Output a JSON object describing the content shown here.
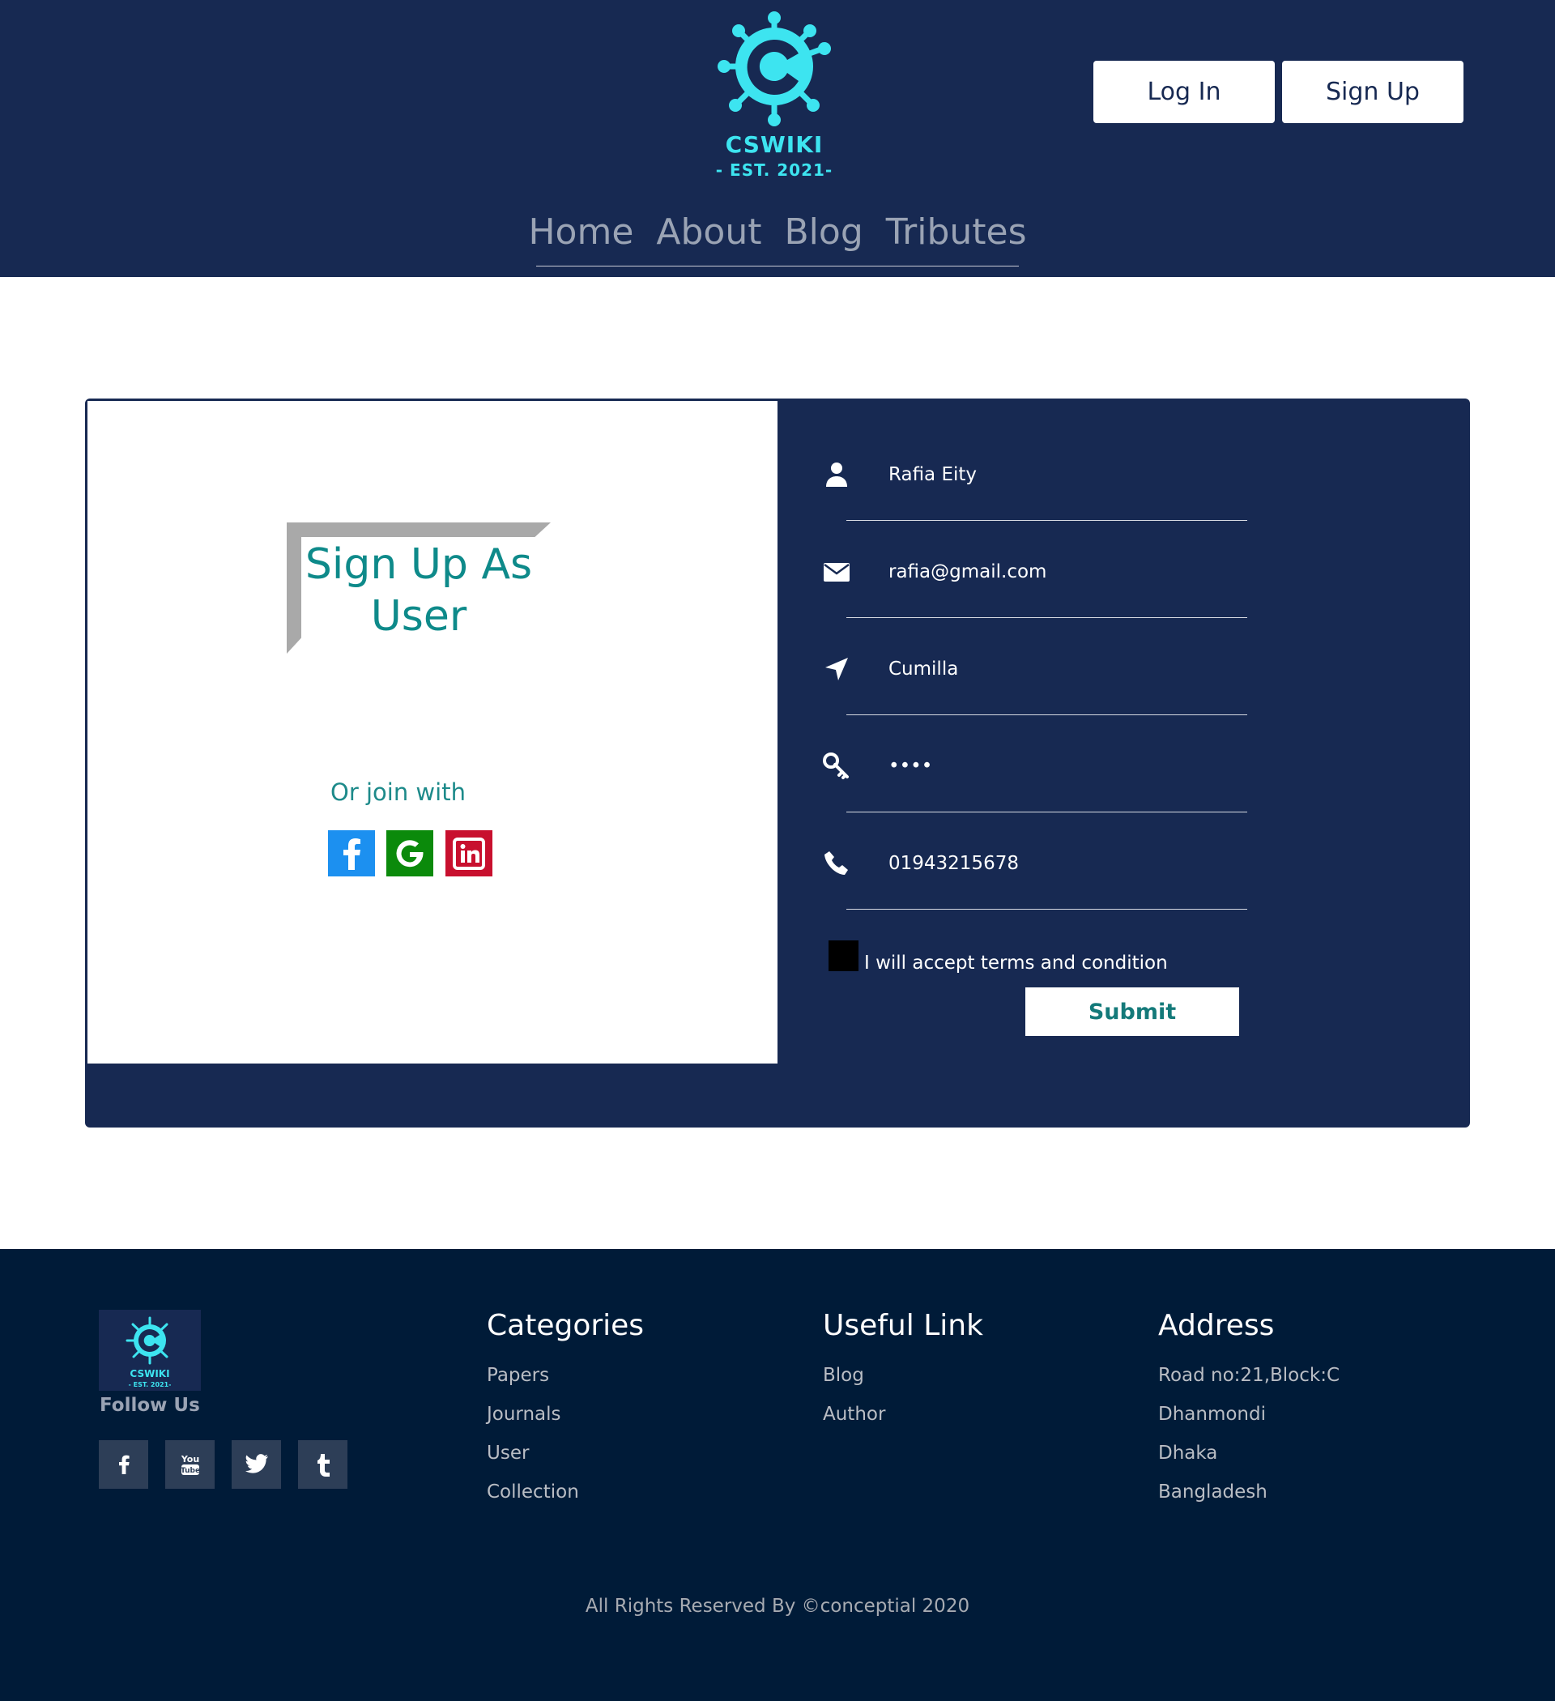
{
  "brand": {
    "name": "CSWIKI",
    "tagline": "- EST. 2021-",
    "accent_color": "#3de4f0",
    "header_bg": "#172952"
  },
  "header": {
    "login_label": "Log In",
    "signup_label": "Sign Up"
  },
  "nav": {
    "items": [
      "Home",
      "About",
      "Blog",
      "Tributes"
    ]
  },
  "signup": {
    "title": "Sign Up As User",
    "join_label": "Or join with",
    "social": [
      {
        "icon": "facebook-icon",
        "color": "#1c90f0"
      },
      {
        "icon": "google-icon",
        "color": "#0b8a0b"
      },
      {
        "icon": "linkedin-icon",
        "color": "#c8102e"
      }
    ]
  },
  "form": {
    "name": {
      "icon": "user-icon",
      "value": "Rafia Eity"
    },
    "email": {
      "icon": "envelope-icon",
      "value": "rafia@gmail.com"
    },
    "location": {
      "icon": "location-arrow-icon",
      "value": "Cumilla"
    },
    "password": {
      "icon": "key-icon",
      "value": "••••"
    },
    "phone": {
      "icon": "phone-icon",
      "value": "01943215678"
    },
    "terms_label": "I will accept terms and condition",
    "submit_label": "Submit"
  },
  "footer": {
    "follow_label": "Follow Us",
    "social": [
      "facebook-icon",
      "youtube-icon",
      "twitter-icon",
      "tumblr-icon"
    ],
    "categories": {
      "title": "Categories",
      "items": [
        "Papers",
        "Journals",
        "User",
        "Collection"
      ]
    },
    "useful_links": {
      "title": "Useful Link",
      "items": [
        "Blog",
        "Author"
      ]
    },
    "address": {
      "title": "Address",
      "lines": [
        "Road no:21,Block:C",
        "Dhanmondi",
        "Dhaka",
        "Bangladesh"
      ]
    },
    "copyright": "All Rights Reserved By ©conceptial 2020",
    "bg_color": "#001b38"
  }
}
